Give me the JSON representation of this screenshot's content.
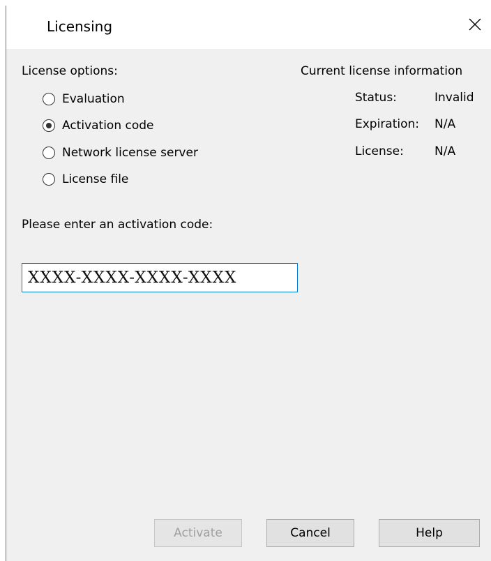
{
  "window": {
    "title": "Licensing"
  },
  "license_options": {
    "heading": "License options:",
    "options": [
      {
        "label": "Evaluation",
        "checked": false
      },
      {
        "label": "Activation code",
        "checked": true
      },
      {
        "label": "Network license server",
        "checked": false
      },
      {
        "label": "License file",
        "checked": false
      }
    ]
  },
  "current_license": {
    "heading": "Current license information",
    "status_label": "Status:",
    "status_value": "Invalid",
    "expiration_label": "Expiration:",
    "expiration_value": "N/A",
    "license_label": "License:",
    "license_value": "N/A"
  },
  "activation": {
    "prompt": "Please enter an activation code:",
    "value": "XXXX-XXXX-XXXX-XXXX"
  },
  "buttons": {
    "activate": "Activate",
    "cancel": "Cancel",
    "help": "Help"
  }
}
